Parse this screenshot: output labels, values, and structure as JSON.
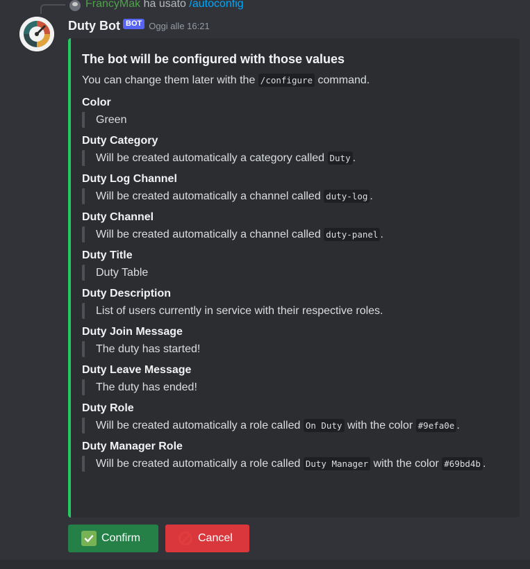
{
  "reply": {
    "username": "FrancyMak",
    "action": " ha usato ",
    "command": "/autoconfig"
  },
  "message": {
    "author": "Duty Bot",
    "badge": "BOT",
    "timestamp": "Oggi alle 16:21"
  },
  "embed": {
    "accent_color": "#23ca5d",
    "title": "The bot will be configured with those values",
    "description_before": "You can change them later with the ",
    "description_code": "/configure",
    "description_after": " command.",
    "fields": [
      {
        "name": "Color",
        "value": "Green"
      },
      {
        "name": "Duty Category",
        "before": "Will be created automatically a category called ",
        "code": "Duty",
        "after": "."
      },
      {
        "name": "Duty Log Channel",
        "before": "Will be created automatically a channel called ",
        "code": "duty-log",
        "after": "."
      },
      {
        "name": "Duty Channel",
        "before": "Will be created automatically a channel called ",
        "code": "duty-panel",
        "after": "."
      },
      {
        "name": "Duty Title",
        "value": "Duty Table"
      },
      {
        "name": "Duty Description",
        "value": "List of users currently in service with their respective roles."
      },
      {
        "name": "Duty Join Message",
        "value": "The duty has started!"
      },
      {
        "name": "Duty Leave Message",
        "value": "The duty has ended!"
      },
      {
        "name": "Duty Role",
        "before": "Will be created automatically a role called ",
        "code": "On Duty",
        "middle": " with the color ",
        "code2": "#9efa0e",
        "after": "."
      },
      {
        "name": "Duty Manager Role",
        "before": "Will be created automatically a role called ",
        "code": "Duty Manager",
        "middle": " with the color ",
        "code2": "#69bd4b",
        "after": "."
      }
    ]
  },
  "buttons": {
    "confirm_label": "Confirm",
    "cancel_label": "Cancel",
    "confirm_icon": "check-mark-icon",
    "cancel_icon": "no-entry-icon"
  }
}
